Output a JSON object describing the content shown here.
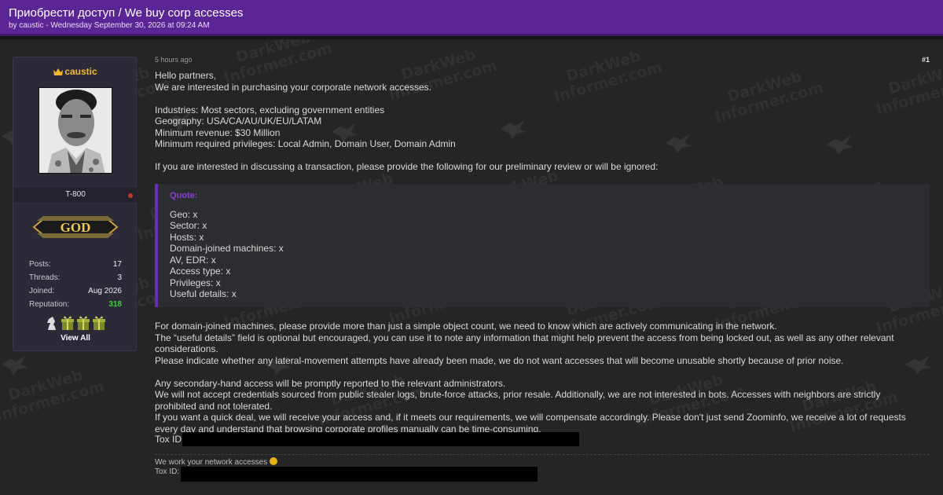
{
  "thread": {
    "title": "Приобрести доступ / We buy corp accesses",
    "meta": "by caustic - Wednesday September 30, 2026 at 09:24 AM"
  },
  "watermark": {
    "line1": "DarkWeb",
    "line2": "Informer.com"
  },
  "user": {
    "username": "caustic",
    "user_title": "T-800",
    "rank_label": "GOD",
    "stats": [
      {
        "label": "Posts:",
        "value": "17"
      },
      {
        "label": "Threads:",
        "value": "3"
      },
      {
        "label": "Joined:",
        "value": "Aug 2026"
      },
      {
        "label": "Reputation:",
        "value": "318"
      }
    ],
    "view_all": "View All"
  },
  "post": {
    "time": "5 hours ago",
    "number": "#1",
    "intro": [
      "Hello partners,",
      "We are interested in purchasing your corporate network accesses."
    ],
    "criteria": [
      "Industries: Most sectors, excluding government entities",
      "Geography: USA/CA/AU/UK/EU/LATAM",
      "Minimum revenue: $30 Million",
      "Minimum required privileges: Local Admin, Domain User, Domain Admin"
    ],
    "request": "If you are interested in discussing a transaction, please provide the following for our preliminary review or will be ignored:",
    "quote": {
      "label": "Quote:",
      "lines": [
        "Geo: x",
        "Sector: x",
        "Hosts: x",
        "Domain-joined machines: x",
        "AV, EDR: x",
        "Access type: x",
        "Privileges: x",
        "Useful details: x"
      ]
    },
    "notes": [
      "For domain-joined machines, please provide more than just a simple object count, we need to know which are actively communicating in the network.",
      "The “useful details” field is optional but encouraged, you can use it to note any information that might help prevent the access from being locked out, as well as any other relevant considerations.",
      "Please indicate whether any lateral-movement attempts have already been made, we do not want accesses that will become unusable shortly because of prior noise."
    ],
    "rules": [
      "Any secondary-hand access will be promptly reported to the relevant administrators.",
      "We will not accept credentials sourced from public stealer logs, brute-force attacks, prior resale. Additionally, we are not interested in bots. Accesses with neighbors are strictly prohibited and not tolerated.",
      "If you want a quick deal, we will receive your access and, if it meets our requirements, we will compensate accordingly. Please don't just send Zoominfo, we receive a lot of requests every day and understand that browsing corporate profiles manually can be time-consuming."
    ],
    "tox_label": "Tox ID:",
    "signature": {
      "line1": "We work your network accesses",
      "tox_label": "Tox ID:"
    }
  }
}
